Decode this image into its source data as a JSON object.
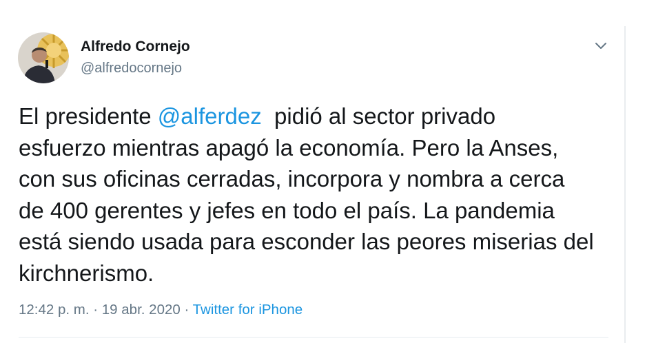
{
  "tweet": {
    "author": {
      "name": "Alfredo Cornejo",
      "handle": "@alfredocornejo"
    },
    "menu_icon": "chevron-down-icon",
    "body": {
      "line1_before": "El presidente ",
      "line1_mention": "@alferdez",
      "line1_after": "  pidió al sector privado",
      "line2": "esfuerzo mientras apagó la economía. Pero la Anses,",
      "line3": "con sus oficinas cerradas, incorpora y nombra a cerca",
      "line4": "de 400 gerentes y jefes en todo el país. La pandemia",
      "line5": "está siendo usada para esconder las peores miserias del",
      "line6": "kirchnerismo."
    },
    "meta": {
      "time": "12:42 p. m.",
      "sep1": " · ",
      "date": "19 abr. 2020",
      "sep2": " · ",
      "source": "Twitter for iPhone"
    },
    "colors": {
      "link": "#1b95e0",
      "text": "#14171a",
      "muted": "#657786"
    }
  }
}
